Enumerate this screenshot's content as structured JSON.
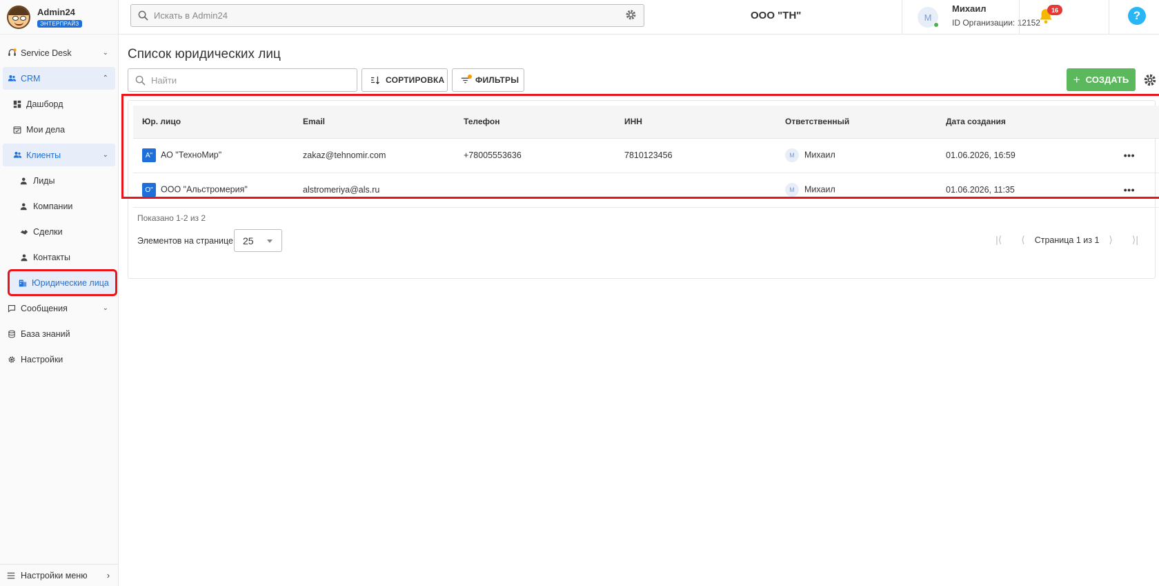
{
  "app": {
    "name": "Admin24",
    "edition_badge": "ЭНТЕРПРАЙЗ"
  },
  "sidebar": {
    "items": [
      {
        "label": "Service Desk"
      },
      {
        "label": "CRM"
      },
      {
        "label": "Дашборд"
      },
      {
        "label": "Мои дела"
      },
      {
        "label": "Клиенты"
      },
      {
        "label": "Лиды"
      },
      {
        "label": "Компании"
      },
      {
        "label": "Сделки"
      },
      {
        "label": "Контакты"
      },
      {
        "label": "Юридические лица"
      },
      {
        "label": "Сообщения"
      },
      {
        "label": "База знаний"
      },
      {
        "label": "Настройки"
      }
    ],
    "menu_settings": "Настройки меню"
  },
  "topbar": {
    "search_placeholder": "Искать в Admin24",
    "org_name": "ООО \"ТН\"",
    "user": {
      "initial": "М",
      "name": "Михаил",
      "org_id": "ID Организации: 12152"
    },
    "notifications_count": "16",
    "help_label": "?"
  },
  "main": {
    "title": "Список юридических лиц",
    "find_placeholder": "Найти",
    "sort_label": "СОРТИРОВКА",
    "filter_label": "ФИЛЬТРЫ",
    "create_label": "СОЗДАТЬ",
    "table": {
      "headers": [
        "Юр. лицо",
        "Email",
        "Телефон",
        "ИНН",
        "Ответственный",
        "Дата создания"
      ],
      "rows": [
        {
          "icon": "А\"",
          "name": "АО \"ТехноМир\"",
          "email": "zakaz@tehnomir.com",
          "phone": "+78005553636",
          "inn": "7810123456",
          "resp_initial": "М",
          "responsible": "Михаил",
          "created": "01.06.2026, 16:59"
        },
        {
          "icon": "О\"",
          "name": "ООО \"Альстромерия\"",
          "email": "alstromeriya@als.ru",
          "phone": "",
          "inn": "",
          "resp_initial": "М",
          "responsible": "Михаил",
          "created": "01.06.2026, 11:35"
        }
      ]
    },
    "shown": "Показано 1-2 из 2",
    "per_page_label": "Элементов на странице",
    "per_page_value": "25",
    "page_label": "Страница 1 из 1"
  },
  "colors": {
    "accent": "#1e6fd9",
    "create_button": "#5cb85c",
    "highlight": "#e8141a",
    "badge": "#e53935"
  }
}
